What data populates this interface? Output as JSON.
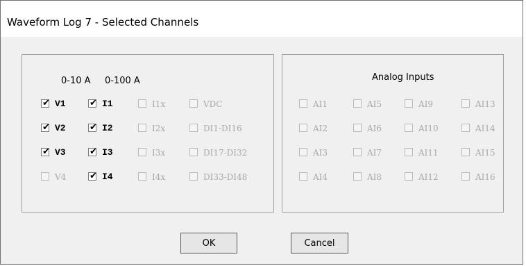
{
  "window": {
    "title": "Waveform Log 7 - Selected Channels"
  },
  "left_group": {
    "header_v": "0-10 A",
    "header_i": "0-100 A",
    "rows": [
      [
        {
          "label": "V1",
          "checked": true,
          "enabled": true
        },
        {
          "label": "I1",
          "checked": true,
          "enabled": true
        },
        {
          "label": "I1x",
          "checked": false,
          "enabled": false
        },
        {
          "label": "VDC",
          "checked": false,
          "enabled": false
        }
      ],
      [
        {
          "label": "V2",
          "checked": true,
          "enabled": true
        },
        {
          "label": "I2",
          "checked": true,
          "enabled": true
        },
        {
          "label": "I2x",
          "checked": false,
          "enabled": false
        },
        {
          "label": "DI1-DI16",
          "checked": false,
          "enabled": false
        }
      ],
      [
        {
          "label": "V3",
          "checked": true,
          "enabled": true
        },
        {
          "label": "I3",
          "checked": true,
          "enabled": true
        },
        {
          "label": "I3x",
          "checked": false,
          "enabled": false
        },
        {
          "label": "DI17-DI32",
          "checked": false,
          "enabled": false
        }
      ],
      [
        {
          "label": "V4",
          "checked": false,
          "enabled": false
        },
        {
          "label": "I4",
          "checked": true,
          "enabled": true
        },
        {
          "label": "I4x",
          "checked": false,
          "enabled": false
        },
        {
          "label": "DI33-DI48",
          "checked": false,
          "enabled": false
        }
      ]
    ]
  },
  "right_group": {
    "title": "Analog Inputs",
    "rows": [
      [
        {
          "label": "AI1",
          "checked": false,
          "enabled": false
        },
        {
          "label": "AI5",
          "checked": false,
          "enabled": false
        },
        {
          "label": "AI9",
          "checked": false,
          "enabled": false
        },
        {
          "label": "AI13",
          "checked": false,
          "enabled": false
        }
      ],
      [
        {
          "label": "AI2",
          "checked": false,
          "enabled": false
        },
        {
          "label": "AI6",
          "checked": false,
          "enabled": false
        },
        {
          "label": "AI10",
          "checked": false,
          "enabled": false
        },
        {
          "label": "AI14",
          "checked": false,
          "enabled": false
        }
      ],
      [
        {
          "label": "AI3",
          "checked": false,
          "enabled": false
        },
        {
          "label": "AI7",
          "checked": false,
          "enabled": false
        },
        {
          "label": "AI11",
          "checked": false,
          "enabled": false
        },
        {
          "label": "AI15",
          "checked": false,
          "enabled": false
        }
      ],
      [
        {
          "label": "AI4",
          "checked": false,
          "enabled": false
        },
        {
          "label": "AI8",
          "checked": false,
          "enabled": false
        },
        {
          "label": "AI12",
          "checked": false,
          "enabled": false
        },
        {
          "label": "AI16",
          "checked": false,
          "enabled": false
        }
      ]
    ]
  },
  "buttons": {
    "ok": "OK",
    "cancel": "Cancel"
  },
  "icons": {
    "checkmark": "checkmark-icon"
  }
}
